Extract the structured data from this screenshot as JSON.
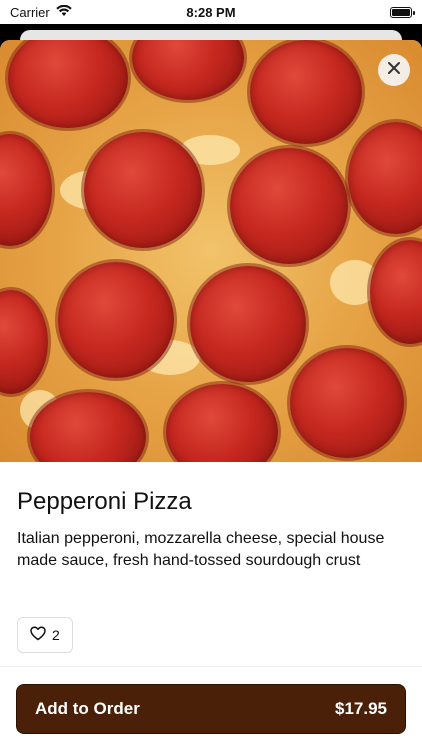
{
  "status_bar": {
    "carrier": "Carrier",
    "time": "8:28 PM"
  },
  "item": {
    "name": "Pepperoni Pizza",
    "description": "Italian pepperoni, mozzarella cheese, special house made sauce, fresh hand-tossed sourdough crust",
    "likes": "2"
  },
  "order": {
    "button_label": "Add to Order",
    "price": "$17.95"
  },
  "icons": {
    "close": "close-icon",
    "heart": "heart-icon",
    "wifi": "wifi-icon",
    "battery": "battery-icon"
  },
  "colors": {
    "order_button_bg": "#4a2108",
    "text": "#111111"
  }
}
